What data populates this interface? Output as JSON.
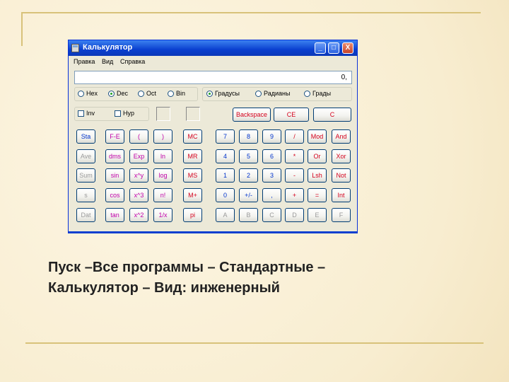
{
  "window": {
    "title": "Калькулятор",
    "controls": {
      "minimize": "_",
      "maximize": "□",
      "close": "X"
    }
  },
  "menu": [
    "Правка",
    "Вид",
    "Справка"
  ],
  "display": {
    "value": "0,"
  },
  "number_system": [
    {
      "label": "Hex",
      "selected": false
    },
    {
      "label": "Dec",
      "selected": true
    },
    {
      "label": "Oct",
      "selected": false
    },
    {
      "label": "Bin",
      "selected": false
    }
  ],
  "angle_units": [
    {
      "label": "Градусы",
      "selected": true
    },
    {
      "label": "Радианы",
      "selected": false
    },
    {
      "label": "Грады",
      "selected": false
    }
  ],
  "checks": {
    "inv": "Inv",
    "hyp": "Hyp"
  },
  "edit_buttons": {
    "backspace": "Backspace",
    "ce": "CE",
    "c": "C"
  },
  "stat_column": [
    "Sta",
    "Ave",
    "Sum",
    "s",
    "Dat"
  ],
  "keypad_rows": [
    [
      "F-E",
      "(",
      ")",
      "MC",
      "7",
      "8",
      "9",
      "/",
      "Mod",
      "And"
    ],
    [
      "dms",
      "Exp",
      "ln",
      "MR",
      "4",
      "5",
      "6",
      "*",
      "Or",
      "Xor"
    ],
    [
      "sin",
      "x^y",
      "log",
      "MS",
      "1",
      "2",
      "3",
      "-",
      "Lsh",
      "Not"
    ],
    [
      "cos",
      "x^3",
      "n!",
      "M+",
      "0",
      "+/-",
      ",",
      "+",
      "=",
      "Int"
    ],
    [
      "tan",
      "x^2",
      "1/x",
      "pi",
      "A",
      "B",
      "C",
      "D",
      "E",
      "F"
    ]
  ],
  "caption": {
    "line1": "Пуск –Все программы – Стандартные –",
    "line2": " Калькулятор – Вид: инженерный"
  }
}
